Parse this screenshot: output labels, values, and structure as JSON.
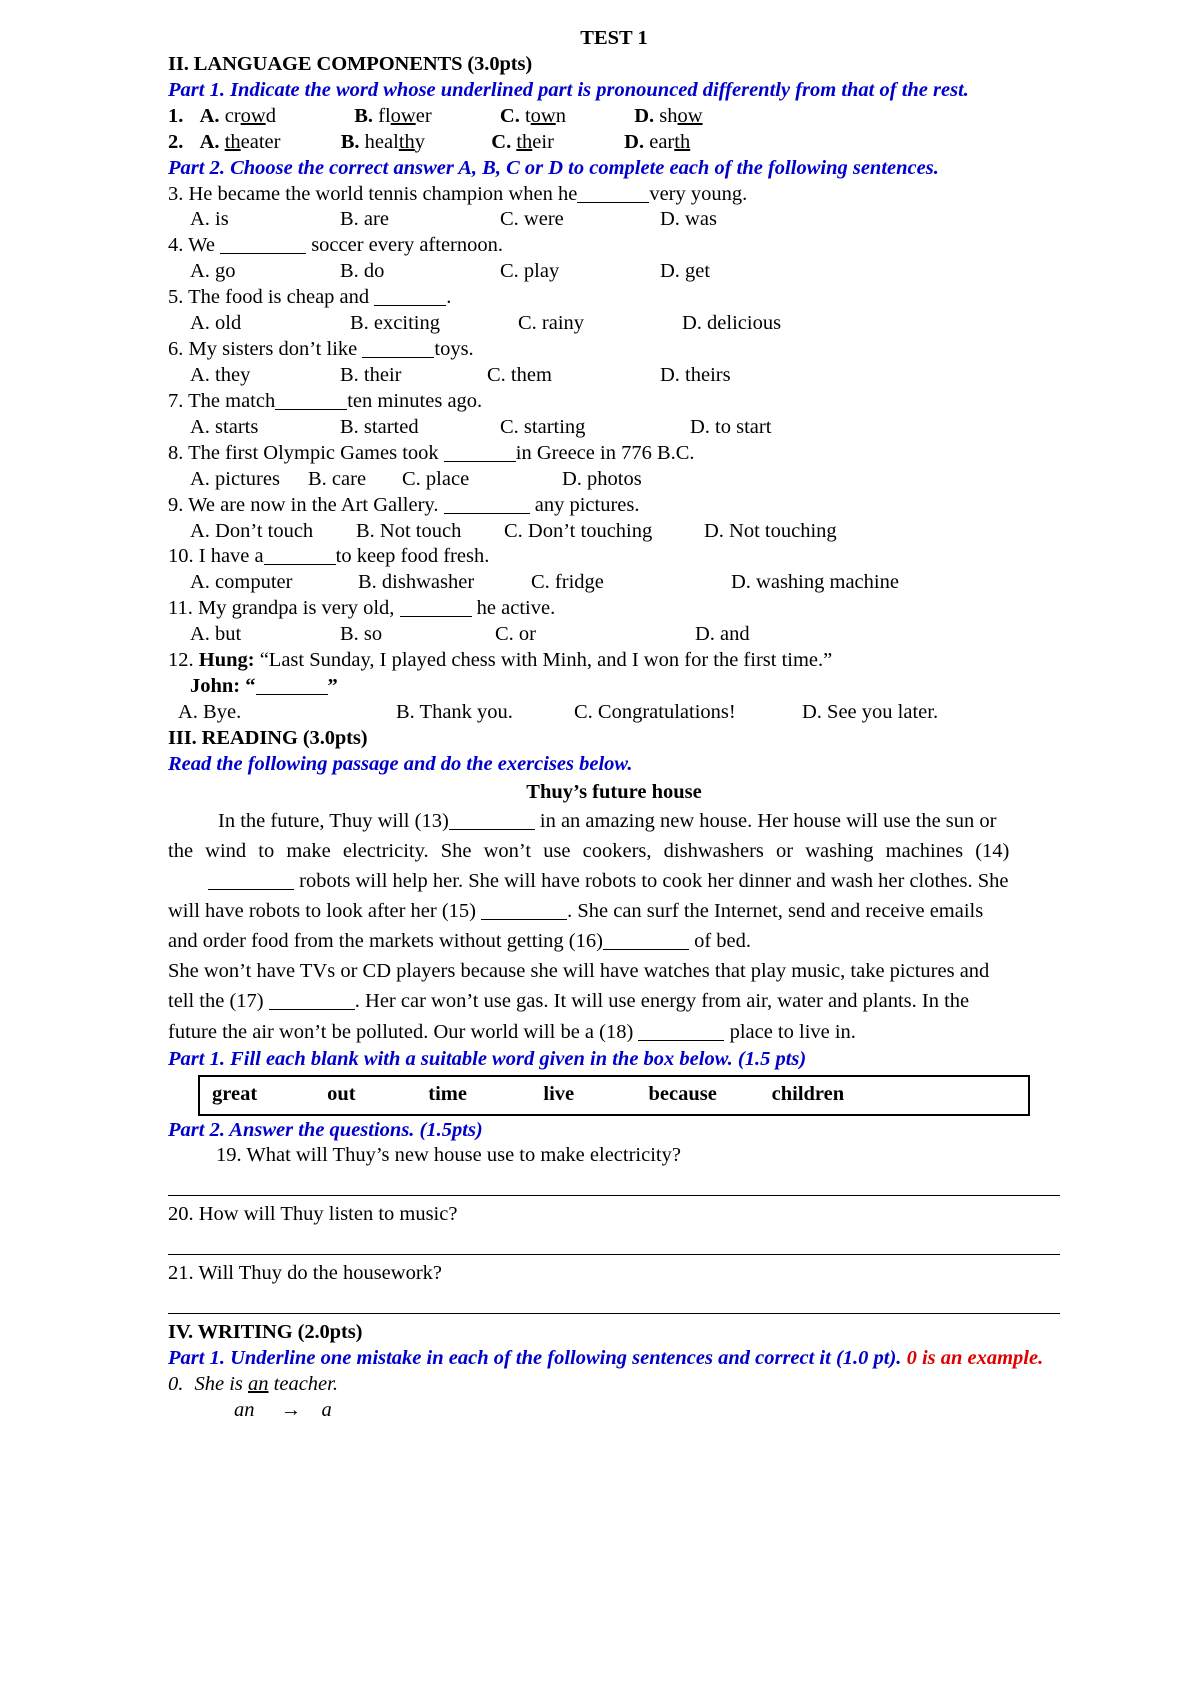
{
  "document": {
    "title": "TEST 1",
    "sections": {
      "language": {
        "heading": "II. LANGUAGE COMPONENTS (3.0pts)",
        "part1_instruction": "Part 1. Indicate the word whose underlined part is pronounced differently from that of the rest.",
        "part2_instruction": "Part 2. Choose the correct answer A, B, C or D to complete each of the following sentences."
      },
      "reading": {
        "heading": "III. READING (3.0pts)",
        "instruction": "Read the following passage and do the exercises below.",
        "passage_title": "Thuy’s future house",
        "part1_instruction": "Part 1. Fill each blank with a suitable word given in the box below. (1.5 pts)",
        "part2_instruction": "Part 2. Answer the questions. (1.5pts)"
      },
      "writing": {
        "heading": "IV. WRITING (2.0pts)",
        "part1_instruction_blue": "Part 1. Underline one mistake in each of the following sentences and correct it (1.0 pt).",
        "part1_instruction_red": "0 is an example."
      }
    },
    "pronunciation_questions": [
      {
        "number": "1.",
        "options": [
          {
            "label": "A.",
            "pre": "cr",
            "ul": "ow",
            "post": "d"
          },
          {
            "label": "B.",
            "pre": "fl",
            "ul": "ow",
            "post": "er"
          },
          {
            "label": "C.",
            "pre": "t",
            "ul": "ow",
            "post": "n"
          },
          {
            "label": "D.",
            "pre": "sh",
            "ul": "ow",
            "post": ""
          }
        ]
      },
      {
        "number": "2.",
        "options": [
          {
            "label": "A.",
            "pre": "",
            "ul": "th",
            "post": "eater"
          },
          {
            "label": "B.",
            "pre": "heal",
            "ul": "th",
            "post": "y"
          },
          {
            "label": "C.",
            "pre": "",
            "ul": "th",
            "post": "eir"
          },
          {
            "label": "D.",
            "pre": "ear",
            "ul": "th",
            "post": ""
          }
        ]
      }
    ],
    "multiple_choice": [
      {
        "number": "3.",
        "stem_before": "He became the world tennis champion when he",
        "stem_after": "very young.",
        "options": [
          "A. is",
          "B. are",
          "C. were",
          "D. was"
        ]
      },
      {
        "number": "4.",
        "stem_before": "We",
        "stem_after": "soccer every afternoon.",
        "options": [
          "A. go",
          "B. do",
          "C. play",
          "D. get"
        ]
      },
      {
        "number": "5.",
        "stem_before": "The food is cheap and",
        "stem_after": ".",
        "options": [
          "A. old",
          "B. exciting",
          "C. rainy",
          "D. delicious"
        ]
      },
      {
        "number": "6.",
        "stem_before": "My sisters don’t like",
        "stem_after": "toys.",
        "options": [
          "A. they",
          "B. their",
          "C. them",
          "D. theirs"
        ]
      },
      {
        "number": "7.",
        "stem_before": "The match",
        "stem_after": "ten minutes ago.",
        "options": [
          "A. starts",
          "B. started",
          "C. starting",
          "D. to start"
        ]
      },
      {
        "number": "8.",
        "stem_before": "The first Olympic Games took",
        "stem_after": "in Greece in 776 B.C.",
        "options": [
          "A. pictures",
          "B. care",
          "C. place",
          "D. photos"
        ]
      },
      {
        "number": "9.",
        "stem_before": "We are now in the Art Gallery.",
        "stem_after": "any pictures.",
        "options": [
          "A. Don’t touch",
          "B. Not touch",
          "C. Don’t touching",
          "D. Not touching"
        ]
      },
      {
        "number": "10.",
        "stem_before": "I have a",
        "stem_after": "to keep food fresh.",
        "options": [
          "A. computer",
          "B. dishwasher",
          "C. fridge",
          "D. washing machine"
        ]
      },
      {
        "number": "11.",
        "stem_before": "My grandpa is very old,",
        "stem_after": "he active.",
        "options": [
          "A. but",
          "B. so",
          "C. or",
          "D. and"
        ]
      }
    ],
    "dialogue_question": {
      "number": "12.",
      "speaker1": "Hung:",
      "speaker1_text": "“Last Sunday, I played chess with Minh, and I won for the first time.”",
      "speaker2": "John:",
      "speaker2_open": "“",
      "speaker2_close": "”",
      "options": [
        "A. Bye.",
        "B. Thank you.",
        "C. Congratulations!",
        "D. See you later."
      ]
    },
    "passage_lines": [
      {
        "indent": true,
        "parts": [
          "In the future, Thuy will (13)",
          "BLANK",
          " in an amazing new house. Her house will use the sun or"
        ]
      },
      {
        "indent": false,
        "parts": [
          "the wind to make electricity. She won’t use cookers, dishwashers or washing machines (14)"
        ]
      },
      {
        "indent": false,
        "parts": [
          "BLANK",
          " robots will help her. She will have robots to cook her dinner and wash her clothes. She"
        ]
      },
      {
        "indent": false,
        "parts": [
          "will have robots to look after her (15) ",
          "BLANK",
          ". She can surf the Internet, send and receive emails"
        ]
      },
      {
        "indent": false,
        "parts": [
          "and order food from the markets without getting (16)",
          "BLANK",
          " of bed."
        ]
      },
      {
        "indent": false,
        "parts": [
          "She won’t have TVs or CD players because she will have watches that play music, take pictures and"
        ]
      },
      {
        "indent": false,
        "parts": [
          "tell the (17) ",
          "BLANK",
          ". Her car won’t use gas. It will use energy from air, water and plants. In the"
        ]
      },
      {
        "indent": false,
        "parts": [
          "future the air won’t be polluted. Our world will be a (18) ",
          "BLANK",
          " place to live in."
        ]
      }
    ],
    "word_box": [
      "great",
      "out",
      "time",
      "live",
      "because",
      "children"
    ],
    "reading_questions": [
      {
        "number": "19.",
        "text": "What will Thuy’s new house use to make electricity?",
        "indented": true
      },
      {
        "number": "20.",
        "text": "How will Thuy listen to music?",
        "indented": false
      },
      {
        "number": "21.",
        "text": "Will Thuy do the housework?",
        "indented": false
      }
    ],
    "writing_example": {
      "number": "0.",
      "sentence_pre": "She is ",
      "sentence_ul": "an",
      "sentence_post": " teacher.",
      "correction_from": "an",
      "correction_arrow": "→",
      "correction_to": "a"
    }
  }
}
